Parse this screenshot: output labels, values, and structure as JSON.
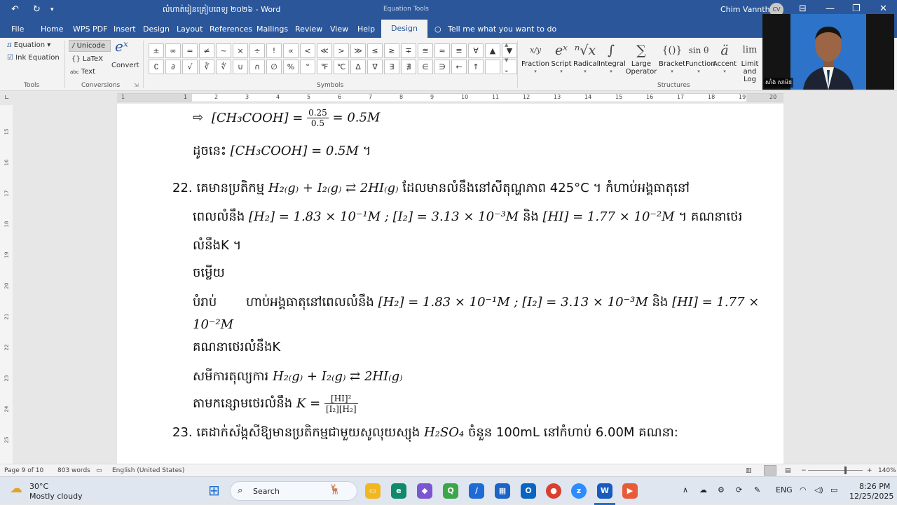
{
  "titlebar": {
    "doc_title": "លំហាត់រៀនគ្រៀបពេទ្យ ២០២៦ - Word",
    "context_tab_group": "Equation Tools",
    "user_name": "Chim Vanntha",
    "user_initials": "CV",
    "undo_icon": "↶",
    "redo_icon": "↻",
    "customize_icon": "▾",
    "ribbon_display_icon": "⊟",
    "minimize_icon": "—",
    "restore_icon": "❐",
    "close_icon": "✕"
  },
  "tabs": [
    "File",
    "Home",
    "WPS PDF",
    "Insert",
    "Design",
    "Layout",
    "References",
    "Mailings",
    "Review",
    "View",
    "Help"
  ],
  "active_tab": "Design",
  "tell_me": "Tell me what you want to do",
  "ribbon": {
    "tools": {
      "equation": "Equation",
      "ink": "Ink Equation",
      "label": "Tools"
    },
    "conversions": {
      "unicode": "Unicode",
      "latex": "LaTeX",
      "text": "Text",
      "convert": "Convert",
      "label": "Conversions"
    },
    "symbols_label": "Symbols",
    "symbols": [
      "±",
      "∞",
      "=",
      "≠",
      "~",
      "×",
      "÷",
      "!",
      "∝",
      "<",
      "≪",
      ">",
      "≫",
      "≤",
      "≥",
      "∓",
      "≅",
      "≈",
      "≡",
      "∀",
      "▲",
      "▼",
      "∁",
      "∂",
      "√",
      "∛",
      "∜",
      "∪",
      "∩",
      "∅",
      "%",
      "°",
      "℉",
      "℃",
      "∆",
      "∇",
      "∃",
      "∄",
      "∈",
      "∋",
      "←",
      "↑",
      "",
      ""
    ],
    "structures_label": "Structures",
    "structures": [
      {
        "icon": "x/y",
        "label": "Fraction"
      },
      {
        "icon": "eˣ",
        "label": "Script"
      },
      {
        "icon": "ⁿ√x",
        "label": "Radical"
      },
      {
        "icon": "∫",
        "label": "Integral"
      },
      {
        "icon": "∑",
        "label": "Large Operator"
      },
      {
        "icon": "{()}",
        "label": "Bracket"
      },
      {
        "icon": "sin θ",
        "label": "Function"
      },
      {
        "icon": "ä",
        "label": "Accent"
      },
      {
        "icon": "lim",
        "label": "Limit and Log"
      }
    ]
  },
  "webcam": {
    "name": "សាំង សាម៉ន"
  },
  "ruler": [
    "1",
    "1",
    "2",
    "3",
    "4",
    "5",
    "6",
    "7",
    "8",
    "9",
    "10",
    "11",
    "12",
    "13",
    "14",
    "15",
    "16",
    "17",
    "18",
    "19",
    "20"
  ],
  "vruler": [
    "15",
    "16",
    "17",
    "18",
    "19",
    "20",
    "21",
    "22",
    "23",
    "24",
    "25"
  ],
  "doc": {
    "l1_arrow": "⇨",
    "l1_lhs": "[CH₃COOH] =",
    "l1_num": "0.25",
    "l1_den": "0.5",
    "l1_rhs": "= 0.5M",
    "l2_km": "ដូចនេះ",
    "l2_math": "[CH₃COOH] = 0.5M",
    "l2_end": "។",
    "q22_num": "22.",
    "q22_a": "គេមានប្រតិកម្ម",
    "q22_eq": "H₂₍g₎ + I₂₍g₎ ⇄ 2HI₍g₎",
    "q22_b": "ដែលមានលំនឹងនៅសីតុណ្ហភាព 425°C ។ កំហាប់អង្គធាតុនៅ",
    "q22_c": "ពេលលំនឹង",
    "q22_vals": "[H₂] = 1.83 × 10⁻¹M ; [I₂] = 3.13 × 10⁻³M",
    "q22_and": "និង",
    "q22_hi": "[HI] = 1.77 × 10⁻²M",
    "q22_d": "។        គណនាថេរ",
    "q22_e": "លំនឹងK ។",
    "answer": "ចម្លើយ",
    "given_label": "បំរាប់",
    "given_a": "ហាប់អង្គធាតុនៅពេលលំនឹង",
    "given_vals": "[H₂] = 1.83 × 10⁻¹M ; [I₂] = 3.13 × 10⁻³M",
    "given_and": "និង",
    "given_hi": "[HI] = 1.77 ×",
    "given_cont": "10⁻²M",
    "find": "គណនាថេរលំនឹងK",
    "balanced_label": "សមីការតុល្យការ",
    "balanced_eq": "H₂₍g₎ + I₂₍g₎ ⇄ 2HI₍g₎",
    "formula_label": "តាមកន្សោមថេរលំនឹង",
    "formula_lhs": "K =",
    "formula_num": "[HI]²",
    "formula_den": "[I₂][H₂]",
    "q23_num": "23.",
    "q23_a": "គេដាក់ស័ង្កសីឱ្យមានប្រតិកម្មជាមួយសូលុយស្យុង",
    "q23_eq": "H₂SO₄",
    "q23_b": "ចំនួន 100mL នៅកំហាប់ 6.00M គណនា:"
  },
  "status": {
    "page": "Page 9 of 10",
    "words": "803 words",
    "lang": "English (United States)",
    "zoom": "140%",
    "zoom_level": 0.68
  },
  "taskbar": {
    "temp": "30°C",
    "weather": "Mostly cloudy",
    "search": "Search",
    "lang": "ENG",
    "time": "8:26 PM",
    "date": "12/25/2025"
  }
}
